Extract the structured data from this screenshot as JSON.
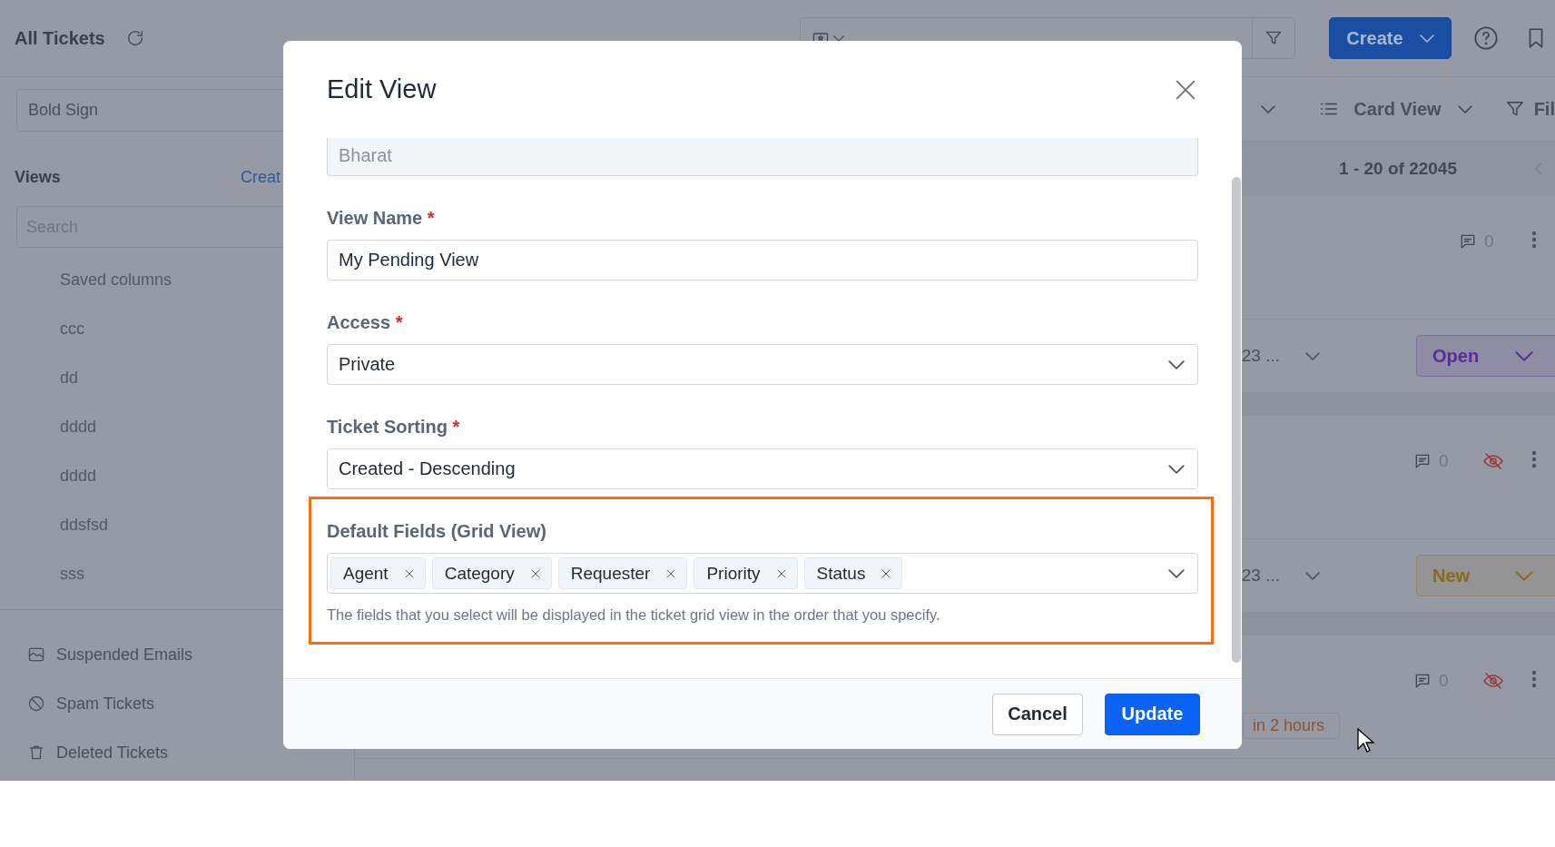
{
  "sidebar": {
    "title": "All Tickets",
    "brand_select": "Bold Sign",
    "views_heading": "Views",
    "create_link": "Creat",
    "search_placeholder": "Search",
    "views": [
      "Saved columns",
      "ccc",
      "dd",
      "dddd",
      "dddd",
      "ddsfsd",
      "sss"
    ],
    "folders": [
      {
        "label": "Suspended Emails",
        "kind": "suspended"
      },
      {
        "label": "Spam Tickets",
        "kind": "spam"
      },
      {
        "label": "Deleted Tickets",
        "kind": "deleted"
      }
    ]
  },
  "toolbar": {
    "create_button": "Create",
    "view_mode": "Card View",
    "filter_label": "Fil",
    "pagination": "1 - 20 of 22045"
  },
  "tickets": [
    {
      "comments": "0",
      "private": false,
      "date": "23 ...",
      "status": {
        "label": "Open",
        "color": "#5b2a9e"
      }
    },
    {
      "comments": "0",
      "private": true,
      "date": "23 ...",
      "status": {
        "label": "New",
        "color": "#8a6a1e"
      }
    },
    {
      "comments": "0",
      "private": true,
      "due": "in 2 hours"
    }
  ],
  "modal": {
    "title": "Edit View",
    "fields": [
      {
        "kind": "disabled",
        "value": "Bharat"
      },
      {
        "kind": "text",
        "label": "View Name",
        "required_mark": "*",
        "value": "My Pending View"
      },
      {
        "kind": "select",
        "label": "Access",
        "required_mark": "*",
        "value": "Private"
      },
      {
        "kind": "select",
        "label": "Ticket Sorting",
        "required_mark": "*",
        "value": "Created - Descending"
      }
    ],
    "default_fields": {
      "label": "Default Fields (Grid View)",
      "highlighted": true,
      "chips": [
        "Agent",
        "Category",
        "Requester",
        "Priority",
        "Status"
      ],
      "help": "The fields that you select will be displayed in the ticket grid view in the order that you specify."
    },
    "buttons": [
      {
        "label": "Cancel",
        "kind": "secondary"
      },
      {
        "label": "Update",
        "kind": "primary"
      }
    ]
  }
}
